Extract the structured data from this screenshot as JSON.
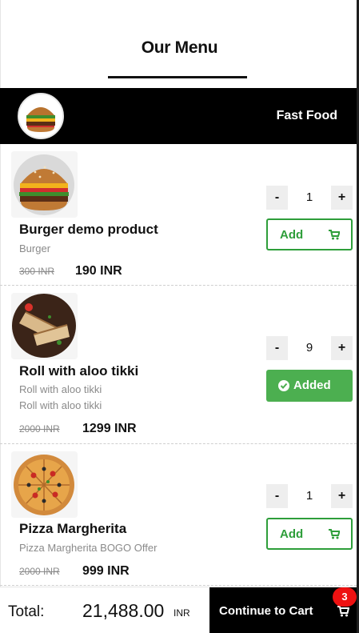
{
  "header": {
    "title": "Our Menu"
  },
  "category": {
    "name": "Fast Food",
    "icon": "burger-thumbnail"
  },
  "products": [
    {
      "name": "Burger demo product",
      "desc": [
        "Burger"
      ],
      "old_price": "300 INR",
      "price": "190 INR",
      "qty": "1",
      "button": "Add",
      "added": false,
      "image": "burger-image"
    },
    {
      "name": "Roll with aloo tikki",
      "desc": [
        "Roll with aloo tikki",
        "Roll with aloo tikki"
      ],
      "old_price": "2000 INR",
      "price": "1299 INR",
      "qty": "9",
      "button": "Added",
      "added": true,
      "image": "roll-image"
    },
    {
      "name": "Pizza Margherita",
      "desc": [
        "Pizza Margherita BOGO Offer"
      ],
      "old_price": "2000 INR",
      "price": "999 INR",
      "qty": "1",
      "button": "Add",
      "added": false,
      "image": "pizza-image"
    }
  ],
  "qty_controls": {
    "minus": "-",
    "plus": "+"
  },
  "footer": {
    "total_label": "Total:",
    "total_value": "21,488.00",
    "currency": "INR",
    "checkout_label": "Continue to Cart",
    "cart_count": "3"
  },
  "colors": {
    "accent_green": "#2e9e3a",
    "added_green": "#4caf50",
    "badge_red": "#ee1111"
  }
}
